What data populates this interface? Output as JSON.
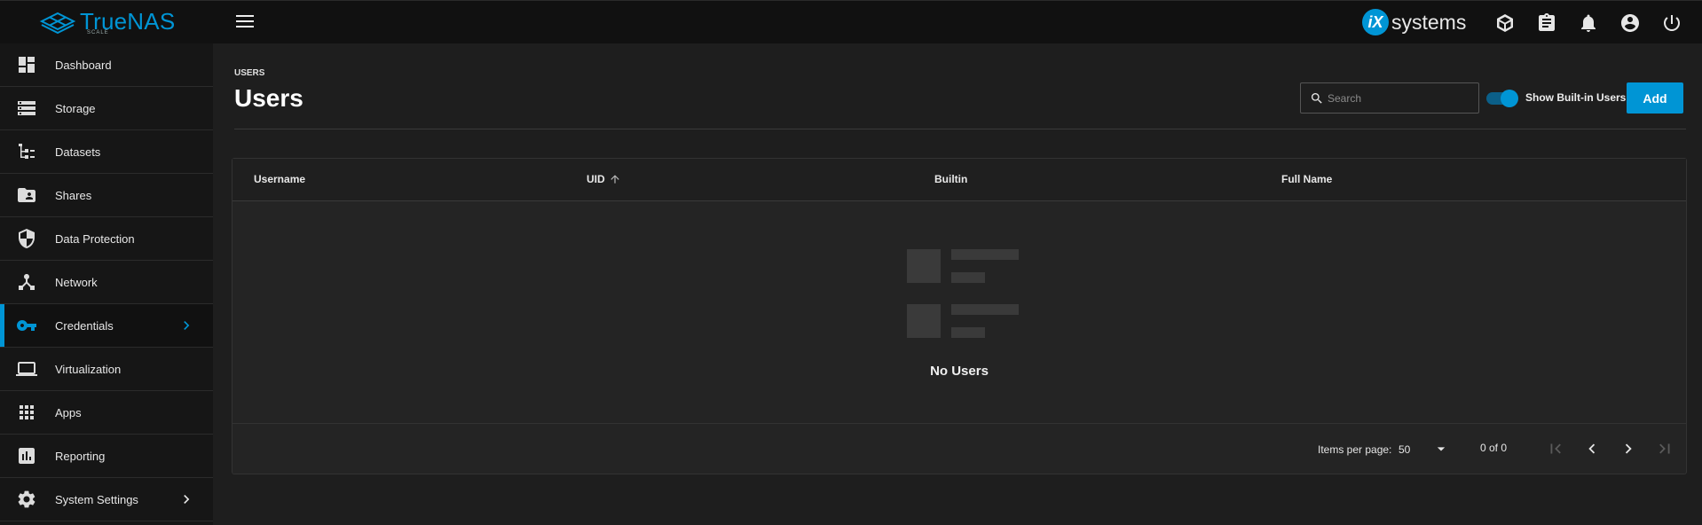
{
  "brand": {
    "name": "TrueNAS",
    "edition": "SCALE",
    "vendor_mark": "iX",
    "vendor_name": "systems",
    "accent": "#0095d5"
  },
  "topbar_icons": [
    "truecommand-icon",
    "clipboard-icon",
    "bell-icon",
    "account-circle-icon",
    "power-icon"
  ],
  "sidebar": {
    "items": [
      {
        "label": "Dashboard",
        "icon": "dashboard-icon"
      },
      {
        "label": "Storage",
        "icon": "storage-icon"
      },
      {
        "label": "Datasets",
        "icon": "datasets-icon"
      },
      {
        "label": "Shares",
        "icon": "shares-folder-icon"
      },
      {
        "label": "Data Protection",
        "icon": "shield-icon"
      },
      {
        "label": "Network",
        "icon": "network-icon"
      },
      {
        "label": "Credentials",
        "icon": "key-icon",
        "active": true,
        "has_submenu": true
      },
      {
        "label": "Virtualization",
        "icon": "laptop-icon"
      },
      {
        "label": "Apps",
        "icon": "apps-grid-icon"
      },
      {
        "label": "Reporting",
        "icon": "chart-icon"
      },
      {
        "label": "System Settings",
        "icon": "gear-icon",
        "has_submenu": true
      }
    ]
  },
  "page": {
    "breadcrumb": "USERS",
    "title": "Users",
    "search_placeholder": "Search",
    "toggle_label": "Show Built-in Users",
    "toggle_on": true,
    "add_label": "Add"
  },
  "table": {
    "columns": [
      {
        "label": "Username"
      },
      {
        "label": "UID",
        "sorted": "ascending"
      },
      {
        "label": "Builtin"
      },
      {
        "label": "Full Name"
      }
    ],
    "empty_text": "No Users",
    "footer": {
      "items_per_page_label": "Items per page:",
      "items_per_page": "50",
      "range": "0 of 0"
    }
  }
}
